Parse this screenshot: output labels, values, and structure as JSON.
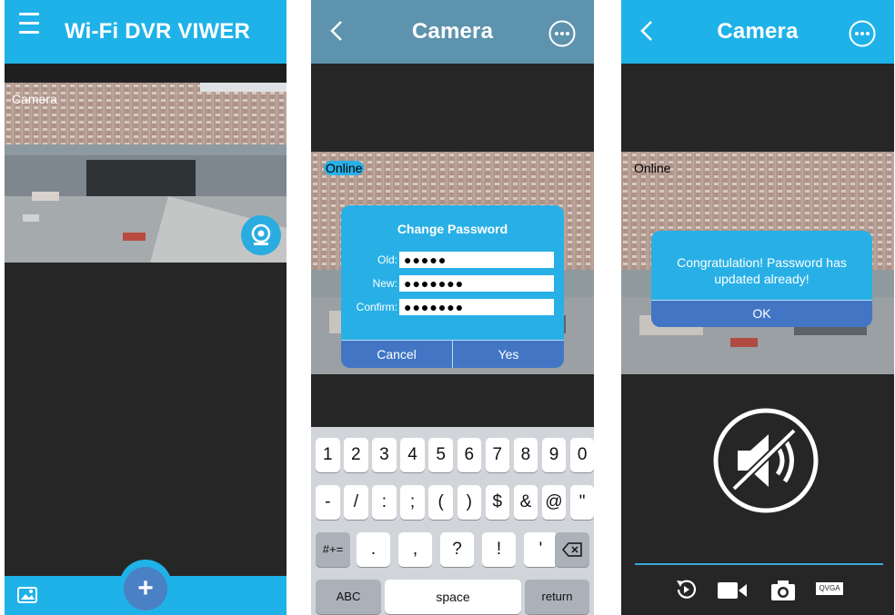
{
  "screen1": {
    "title": "Wi-Fi DVR VIWER",
    "camera_label": "Camera",
    "add_label": "+"
  },
  "screen2": {
    "title": "Camera",
    "status": "Online",
    "dialog": {
      "title": "Change Password",
      "old_label": "Old:",
      "old_value": "●●●●●",
      "new_label": "New:",
      "new_value": "●●●●●●●",
      "confirm_label": "Confirm:",
      "confirm_value": "●●●●●●●",
      "cancel": "Cancel",
      "yes": "Yes"
    },
    "keyboard": {
      "row1": [
        "1",
        "2",
        "3",
        "4",
        "5",
        "6",
        "7",
        "8",
        "9",
        "0"
      ],
      "row2": [
        "-",
        "/",
        ":",
        ";",
        "(",
        ")",
        "$",
        "&",
        "@",
        "\""
      ],
      "row3": [
        ".",
        ",",
        "?",
        "!",
        "'"
      ],
      "more_key": "#+=",
      "abc_key": "ABC",
      "space_key": "space",
      "return_key": "return"
    }
  },
  "screen3": {
    "title": "Camera",
    "status": "Online",
    "message": "Congratulation! Password has updated already!",
    "ok": "OK",
    "quality": "QVGA"
  },
  "colors": {
    "header_blue": "#1fb2e8",
    "header_steel": "#5d93ad",
    "dialog_blue": "#28b0e6",
    "dialog_button": "#4276c5"
  }
}
